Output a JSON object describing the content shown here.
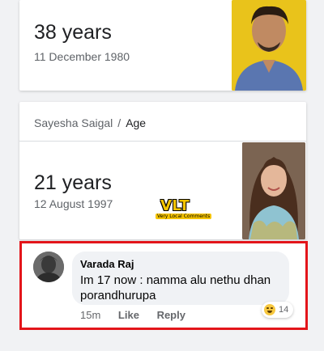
{
  "card1": {
    "age": "38 years",
    "dob": "11 December 1980"
  },
  "card2": {
    "breadcrumb": {
      "first": "Sayesha Saigal",
      "separator": "/",
      "second": "Age"
    },
    "age": "21 years",
    "dob": "12 August 1997"
  },
  "watermark": {
    "main": "VLT",
    "sub": "Very Local Comments"
  },
  "comment": {
    "author": "Varada Raj",
    "text": "Im 17 now : namma alu nethu dhan porandhurupa",
    "time": "15m",
    "like_label": "Like",
    "reply_label": "Reply",
    "reaction_icon": "laughing-emoji-icon",
    "reaction_count": "14"
  },
  "colors": {
    "highlight_border": "#e3151a",
    "photo1_bg": "#e9c31b"
  }
}
